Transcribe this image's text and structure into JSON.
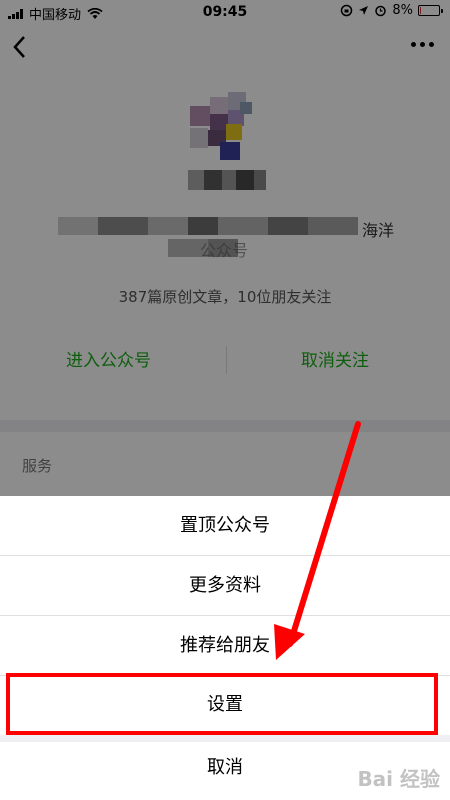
{
  "status_bar": {
    "carrier": "中国移动",
    "time": "09:45",
    "battery_percent_text": "8%",
    "battery_level": 0.08,
    "battery_color": "#ee3333"
  },
  "profile": {
    "description_visible_end": "海洋",
    "description_line2_fragment": "公众号",
    "stats": "387篇原创文章，10位朋友关注",
    "action_enter": "进入公众号",
    "action_unfollow": "取消关注",
    "services_label": "服务",
    "accent_color": "#1aad19"
  },
  "action_sheet": {
    "items": [
      {
        "label": "置顶公众号"
      },
      {
        "label": "更多资料"
      },
      {
        "label": "推荐给朋友"
      },
      {
        "label": "设置"
      }
    ],
    "cancel_label": "取消"
  },
  "annotation": {
    "highlight_color": "#ff0000",
    "watermark": "Bai 经验"
  }
}
